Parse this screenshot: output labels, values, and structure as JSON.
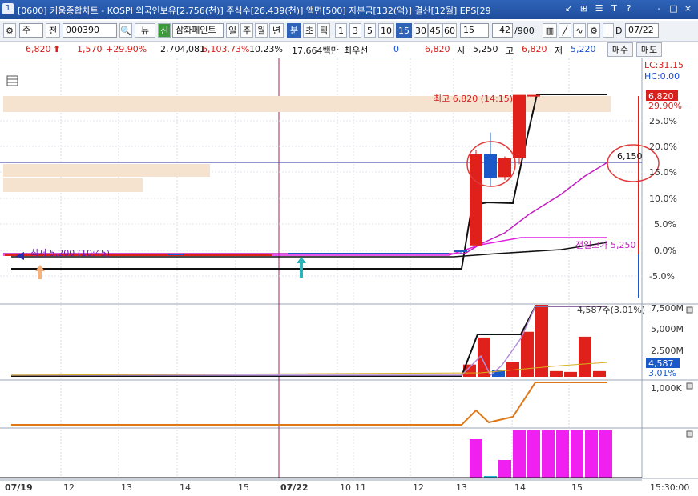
{
  "window": {
    "number": "1",
    "title": "[0600] 키움종합차트 - KOSPI 외국인보유[2,756(천)] 주식수[26,439(천)] 액면[500] 자본금[132(억)] 결산[12월] EPS[29",
    "controls": [
      "↙",
      "⊞",
      "☰",
      "T",
      "?",
      "-",
      "□",
      "×"
    ]
  },
  "toolbar": {
    "market": "주",
    "prefix": "전",
    "code": "000390",
    "news_label": "뉴",
    "credit_label": "신",
    "stock_name": "삼화페인트",
    "periods": [
      "일",
      "주",
      "월",
      "년",
      "분",
      "초",
      "틱"
    ],
    "selected_period": "분",
    "intervals": [
      "1",
      "3",
      "5",
      "10",
      "15",
      "30",
      "45",
      "60"
    ],
    "selected_interval": "15",
    "interval_value": "15",
    "page": "42",
    "page_total": "/900",
    "date": "07/22"
  },
  "quote": {
    "price": "6,820",
    "arrow": "⬆",
    "change": "1,570",
    "change_pct": "+29.90%",
    "volume": "2,704,081",
    "vol_ratio": "6,103.73%",
    "turnover": "10.23%",
    "amount": "17,664백만",
    "priority_label": "최우선",
    "priority_value": "0",
    "ask": "6,820",
    "open_label": "시",
    "open": "5,250",
    "high_label": "고",
    "high": "6,820",
    "low_label": "저",
    "low": "5,220",
    "buy_label": "매수",
    "sell_label": "매도"
  },
  "chart_labels": {
    "lc": "LC:31.15",
    "hc": "HC:0.00",
    "high_note": "최고 6,820 (14:15)",
    "low_note": "최저 5,200 (10:45)",
    "prev_high_note": "전일고가 5,250",
    "ma_value": "6,150",
    "last_price": "6,820",
    "last_pct": "29.90%",
    "volume_note": "4,587주(3.01%)",
    "volume_last": "4,587",
    "volume_last_pct": "3.01%",
    "time_end": "15:30:00"
  },
  "price_axis": [
    "25.0%",
    "20.0%",
    "15.0%",
    "10.0%",
    "5.0%",
    "0.0%",
    "-5.0%"
  ],
  "volume_axis": [
    "7,500M",
    "5,000M",
    "2,500M"
  ],
  "amount_axis": [
    "1,000K"
  ],
  "x_axis": [
    "07/19",
    "12",
    "13",
    "14",
    "15",
    "07/22",
    "10",
    "11",
    "12",
    "13",
    "14",
    "15"
  ],
  "colors": {
    "up": "#e0201a",
    "down": "#1b58c8",
    "title_bar": "#2e63b8",
    "ma_magenta": "#c01ec0",
    "orange": "#e07818",
    "highlight": "#f5e3d0"
  },
  "chart_data": {
    "type": "candlestick",
    "candles": [
      {
        "open": 5250,
        "high": 5250,
        "low": 5220,
        "close": 5240
      },
      {
        "open": 5300,
        "high": 6260,
        "low": 5290,
        "close": 6220
      },
      {
        "open": 6220,
        "high": 6440,
        "low": 5900,
        "close": 5980
      },
      {
        "open": 5990,
        "high": 6200,
        "low": 5960,
        "close": 6180
      },
      {
        "open": 6180,
        "high": 6820,
        "low": 6120,
        "close": 6820
      },
      {
        "open": 6820,
        "high": 6820,
        "low": 6820,
        "close": 6820
      }
    ],
    "volume_bars": [
      1500,
      4800,
      800,
      1800,
      5500,
      8800,
      700,
      600,
      4900,
      700
    ]
  }
}
